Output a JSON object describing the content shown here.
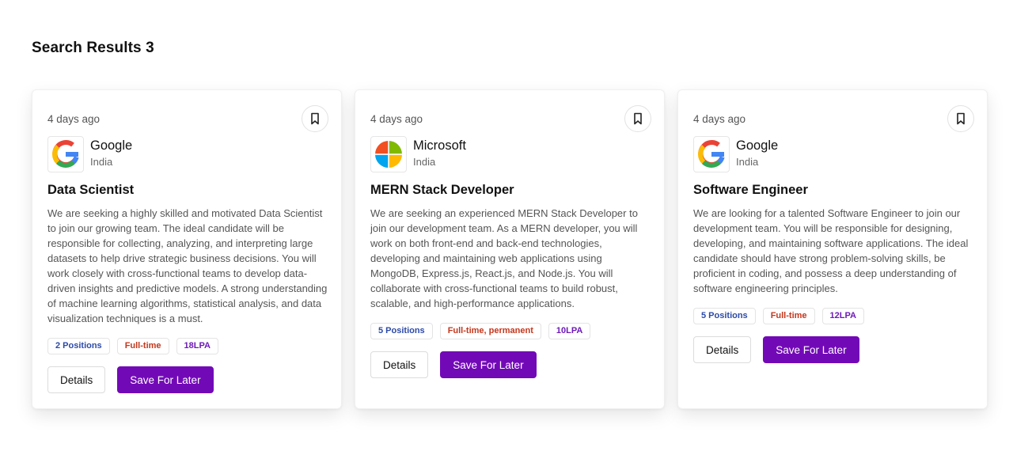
{
  "heading": "Search Results 3",
  "jobs": [
    {
      "posted": "4 days ago",
      "company": "Google",
      "location": "India",
      "logo": "google-logo",
      "title": "Data Scientist",
      "description": "We are seeking a highly skilled and motivated Data Scientist to join our growing team. The ideal candidate will be responsible for collecting, analyzing, and interpreting large datasets to help drive strategic business decisions. You will work closely with cross-functional teams to develop data-driven insights and predictive models. A strong understanding of machine learning algorithms, statistical analysis, and data visualization techniques is a must.",
      "positions": "2 Positions",
      "job_type": "Full-time",
      "salary": "18LPA",
      "details_label": "Details",
      "save_label": "Save For Later"
    },
    {
      "posted": "4 days ago",
      "company": "Microsoft",
      "location": "India",
      "logo": "microsoft-logo",
      "title": "MERN Stack Developer",
      "description": "We are seeking an experienced MERN Stack Developer to join our development team. As a MERN developer, you will work on both front-end and back-end technologies, developing and maintaining web applications using MongoDB, Express.js, React.js, and Node.js. You will collaborate with cross-functional teams to build robust, scalable, and high-performance applications.",
      "positions": "5 Positions",
      "job_type": "Full-time, permanent",
      "salary": "10LPA",
      "details_label": "Details",
      "save_label": "Save For Later"
    },
    {
      "posted": "4 days ago",
      "company": "Google",
      "location": "India",
      "logo": "google-logo",
      "title": "Software Engineer",
      "description": "We are looking for a talented Software Engineer to join our development team. You will be responsible for designing, developing, and maintaining software applications. The ideal candidate should have strong problem-solving skills, be proficient in coding, and possess a deep understanding of software engineering principles.",
      "positions": "5 Positions",
      "job_type": "Full-time",
      "salary": "12LPA",
      "details_label": "Details",
      "save_label": "Save For Later"
    }
  ],
  "colors": {
    "accent": "#7209b7",
    "positions_badge": "#2c4aa8",
    "job_type_badge": "#c5361b",
    "salary_badge": "#6e1ab8"
  },
  "icons": {
    "bookmark": "bookmark-icon"
  }
}
